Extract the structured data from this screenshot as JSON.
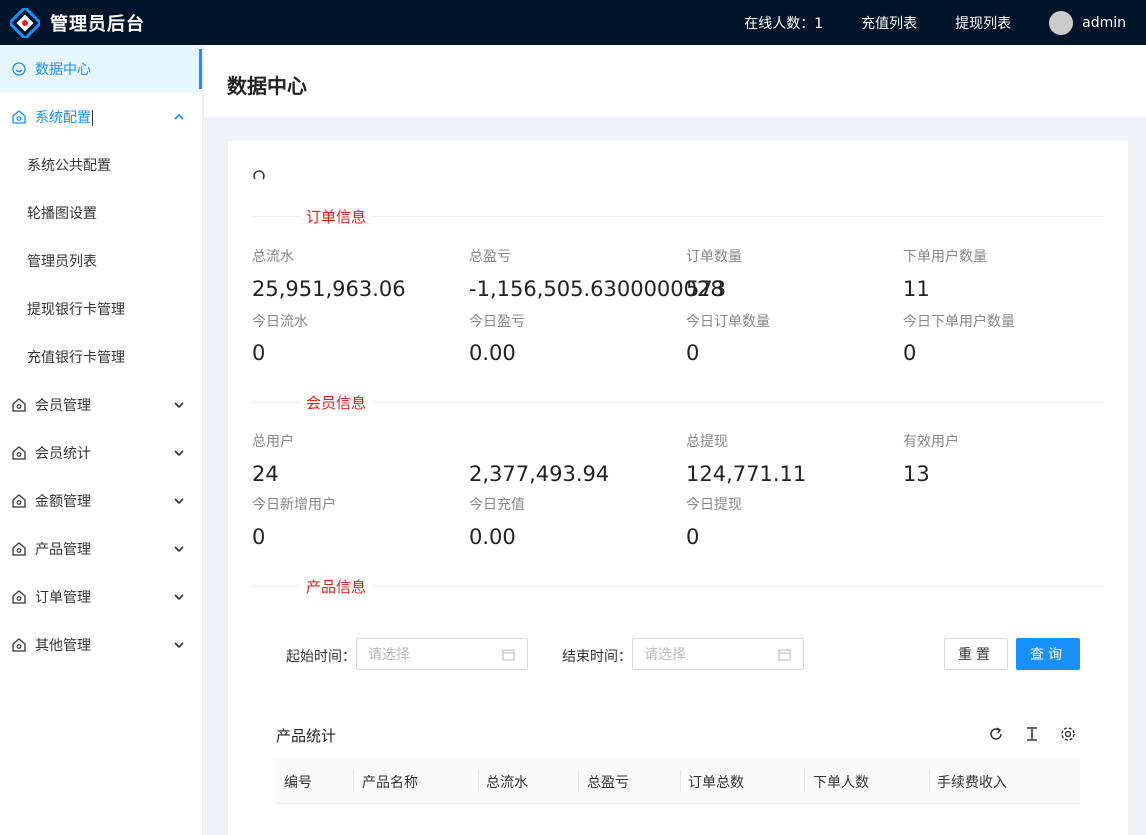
{
  "header": {
    "title": "管理员后台",
    "online": "在线人数：1",
    "links": [
      "充值列表",
      "提现列表"
    ],
    "username": "admin"
  },
  "sidebar": {
    "items": [
      {
        "label": "数据中心",
        "icon": "dashboard-icon"
      },
      {
        "label": "系统配置",
        "icon": "settings-icon"
      },
      {
        "label": "系统公共配置"
      },
      {
        "label": "轮播图设置"
      },
      {
        "label": "管理员列表"
      },
      {
        "label": "提现银行卡管理"
      },
      {
        "label": "充值银行卡管理"
      },
      {
        "label": "会员管理",
        "icon": "home-icon"
      },
      {
        "label": "会员统计",
        "icon": "home-icon"
      },
      {
        "label": "金额管理",
        "icon": "home-icon"
      },
      {
        "label": "产品管理",
        "icon": "home-icon"
      },
      {
        "label": "订单管理",
        "icon": "home-icon"
      },
      {
        "label": "其他管理",
        "icon": "home-icon"
      }
    ]
  },
  "page": {
    "title": "数据中心"
  },
  "sections": {
    "order": "订单信息",
    "member": "会员信息",
    "product": "产品信息"
  },
  "order_stats": [
    {
      "label": "总流水",
      "value": "25,951,963.06"
    },
    {
      "label": "总盈亏",
      "value": "-1,156,505.6300000028"
    },
    {
      "label": "订单数量",
      "value": "573"
    },
    {
      "label": "下单用户数量",
      "value": "11"
    },
    {
      "label": "今日流水",
      "value": "0"
    },
    {
      "label": "今日盈亏",
      "value": "0.00"
    },
    {
      "label": "今日订单数量",
      "value": "0"
    },
    {
      "label": "今日下单用户数量",
      "value": "0"
    }
  ],
  "member_stats": [
    {
      "label": "总用户",
      "value": "24"
    },
    {
      "label": "",
      "value": "2,377,493.94"
    },
    {
      "label": "总提现",
      "value": "124,771.11"
    },
    {
      "label": "有效用户",
      "value": "13"
    },
    {
      "label": "今日新增用户",
      "value": "0"
    },
    {
      "label": "今日充值",
      "value": "0.00"
    },
    {
      "label": "今日提现",
      "value": "0"
    }
  ],
  "filter": {
    "start_label": "起始时间：",
    "end_label": "结束时间：",
    "placeholder": "请选择",
    "reset": "重置",
    "query": "查询"
  },
  "table": {
    "title": "产品统计",
    "columns": [
      "编号",
      "产品名称",
      "总流水",
      "总盈亏",
      "订单总数",
      "下单人数",
      "手续费收入"
    ]
  },
  "colors": {
    "header_bg": "#001529",
    "accent": "#1890ff",
    "section_title": "#e02020"
  }
}
